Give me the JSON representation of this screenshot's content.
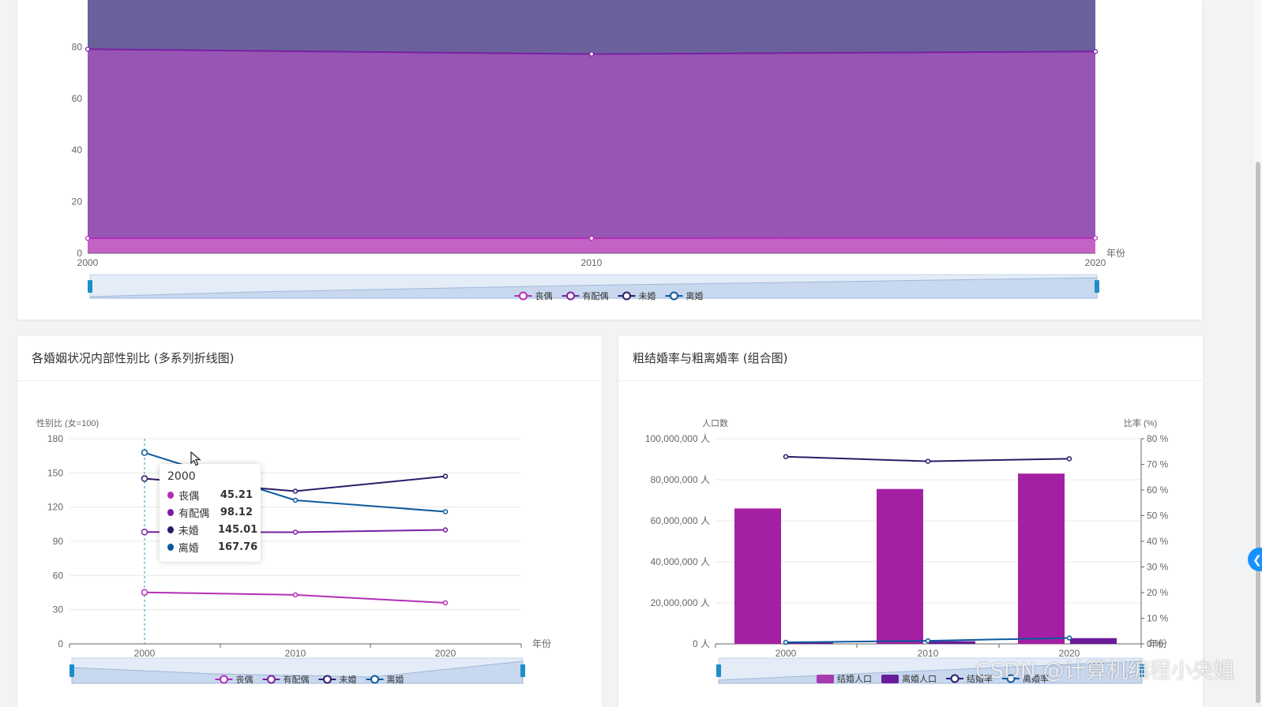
{
  "colors": {
    "bereaved": "#b32fb5",
    "married": "#7b1fa2",
    "unmarried": "#2d1b69",
    "divorced": "#0d5a9e"
  },
  "top_chart": {
    "unit": "年份",
    "legend": [
      "丧偶",
      "有配偶",
      "未婚",
      "离婚"
    ],
    "y_ticks": [
      "0",
      "20",
      "40",
      "60",
      "80"
    ],
    "x_ticks": [
      "2000",
      "2010",
      "2020"
    ]
  },
  "sex_ratio_card": {
    "title": "各婚姻状况内部性别比 (多系列折线图)",
    "y_axis_name": "性别比 (女=100)",
    "x_axis_name": "年份",
    "legend": [
      "丧偶",
      "有配偶",
      "未婚",
      "离婚"
    ],
    "y_ticks": [
      "0",
      "30",
      "60",
      "90",
      "120",
      "150",
      "180"
    ],
    "x_ticks": [
      "2000",
      "2010",
      "2020"
    ],
    "tooltip": {
      "title": "2000",
      "rows": [
        {
          "name": "丧偶",
          "value": "45.21"
        },
        {
          "name": "有配偶",
          "value": "98.12"
        },
        {
          "name": "未婚",
          "value": "145.01"
        },
        {
          "name": "离婚",
          "value": "167.76"
        }
      ]
    }
  },
  "marriage_rate_card": {
    "title": "粗结婚率与粗离婚率 (组合图)",
    "left_axis_name": "人口数",
    "right_axis_name": "比率 (%)",
    "left_ticks": [
      "0 人",
      "20,000,000 人",
      "40,000,000 人",
      "60,000,000 人",
      "80,000,000 人",
      "100,000,000 人"
    ],
    "right_ticks": [
      "0 %",
      "10 %",
      "20 %",
      "30 %",
      "40 %",
      "50 %",
      "60 %",
      "70 %",
      "80 %"
    ],
    "x_axis_name": "年份",
    "x_ticks": [
      "2000",
      "2010",
      "2020"
    ],
    "legend": [
      "结婚人口",
      "离婚人口",
      "结婚率",
      "离婚率"
    ]
  },
  "side_button_icon": "chevron-left-icon",
  "watermark": "CSDN @计算机编程小央姐",
  "chart_data": [
    {
      "type": "area",
      "stacked": true,
      "x": [
        "2000",
        "2010",
        "2020"
      ],
      "xlabel": "年份",
      "series": [
        {
          "name": "丧偶",
          "values": [
            5.8,
            5.8,
            5.9
          ]
        },
        {
          "name": "有配偶",
          "values": [
            73.3,
            71.4,
            72.3
          ]
        },
        {
          "name": "未婚",
          "values": [
            21.0,
            22.8,
            21.9
          ]
        },
        {
          "name": "离婚",
          "values": [
            0,
            0,
            0
          ]
        }
      ]
    },
    {
      "type": "line",
      "title": "各婚姻状况内部性别比 (多系列折线图)",
      "x": [
        "2000",
        "2010",
        "2020"
      ],
      "xlabel": "年份",
      "ylabel": "性别比 (女=100)",
      "ylim": [
        0,
        180
      ],
      "series": [
        {
          "name": "丧偶",
          "values": [
            45.21,
            43,
            36
          ]
        },
        {
          "name": "有配偶",
          "values": [
            98.12,
            98,
            100
          ]
        },
        {
          "name": "未婚",
          "values": [
            145.01,
            134,
            147
          ]
        },
        {
          "name": "离婚",
          "values": [
            167.76,
            126,
            116
          ]
        }
      ]
    },
    {
      "type": "bar",
      "title": "粗结婚率与粗离婚率 (组合图)",
      "categories": [
        "2000",
        "2010",
        "2020"
      ],
      "bars": [
        {
          "name": "结婚人口",
          "values": [
            66000000,
            75500000,
            83000000
          ]
        },
        {
          "name": "离婚人口",
          "values": [
            600000,
            1300000,
            2800000
          ]
        }
      ],
      "lines": [
        {
          "name": "结婚率",
          "values": [
            73,
            71.2,
            72.2
          ]
        },
        {
          "name": "离婚率",
          "values": [
            0.6,
            1.2,
            2.3
          ]
        }
      ],
      "ylim_left": [
        0,
        100000000
      ],
      "ylim_right": [
        0,
        80
      ]
    }
  ]
}
